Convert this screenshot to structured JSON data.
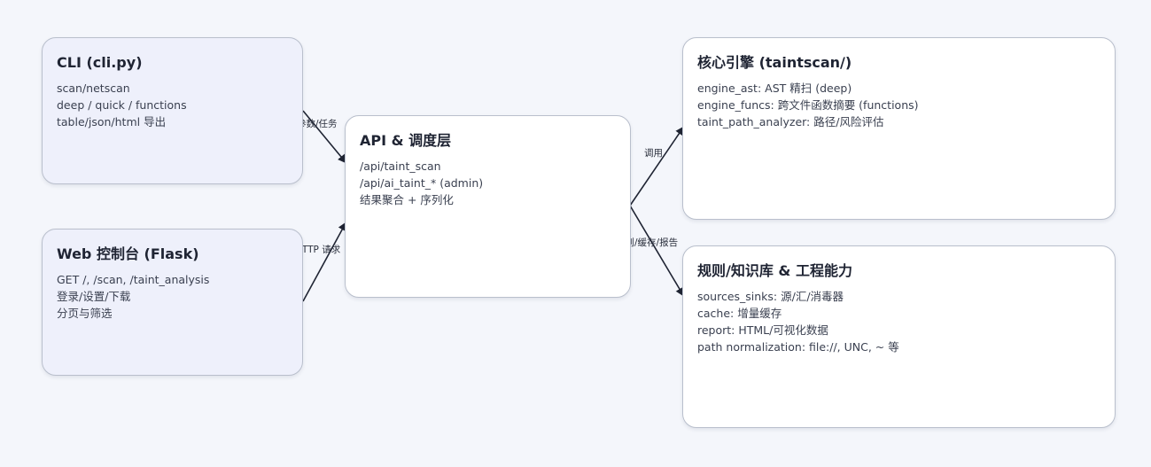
{
  "nodes": {
    "cli": {
      "title": "CLI (cli.py)",
      "lines": [
        "scan/netscan",
        "deep / quick / functions",
        "table/json/html 导出"
      ]
    },
    "web": {
      "title": "Web 控制台 (Flask)",
      "lines": [
        "GET /, /scan, /taint_analysis",
        "登录/设置/下载",
        "分页与筛选"
      ]
    },
    "api": {
      "title": "API & 调度层",
      "lines": [
        "/api/taint_scan",
        "/api/ai_taint_* (admin)",
        "结果聚合 + 序列化"
      ]
    },
    "core": {
      "title": "核心引擎 (taintscan/)",
      "lines": [
        "engine_ast: AST 精扫 (deep)",
        "engine_funcs: 跨文件函数摘要 (functions)",
        "taint_path_analyzer: 路径/风险评估"
      ]
    },
    "rules": {
      "title": "规则/知识库 & 工程能力",
      "lines": [
        "sources_sinks: 源/汇/消毒器",
        "cache: 增量缓存",
        "report: HTML/可视化数据",
        "path normalization: file://, UNC, ~ 等"
      ]
    }
  },
  "edges": {
    "cli_api": "参数/任务",
    "web_api": "HTTP 请求",
    "api_core": "调用",
    "api_rules": "规则/缓存/报告"
  },
  "colors": {
    "client_fill": "#eef0fb",
    "server_fill": "#ffffff",
    "border": "#b9bfcc",
    "arrow": "#1f2433"
  }
}
